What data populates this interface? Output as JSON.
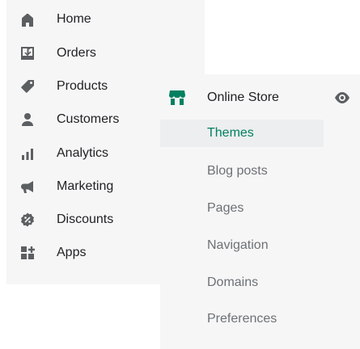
{
  "main_nav": {
    "items": [
      {
        "label": "Home",
        "icon": "home-icon"
      },
      {
        "label": "Orders",
        "icon": "orders-icon"
      },
      {
        "label": "Products",
        "icon": "tag-icon"
      },
      {
        "label": "Customers",
        "icon": "person-icon"
      },
      {
        "label": "Analytics",
        "icon": "bar-chart-icon"
      },
      {
        "label": "Marketing",
        "icon": "megaphone-icon"
      },
      {
        "label": "Discounts",
        "icon": "discount-icon"
      },
      {
        "label": "Apps",
        "icon": "apps-icon"
      }
    ]
  },
  "online_store": {
    "label": "Online Store",
    "icon": "store-icon",
    "view_icon": "eye-icon",
    "items": [
      {
        "label": "Themes",
        "active": true
      },
      {
        "label": "Blog posts",
        "active": false
      },
      {
        "label": "Pages",
        "active": false
      },
      {
        "label": "Navigation",
        "active": false
      },
      {
        "label": "Domains",
        "active": false
      },
      {
        "label": "Preferences",
        "active": false
      }
    ]
  },
  "colors": {
    "panel_bg": "#f6f6f7",
    "icon": "#5c5f62",
    "text": "#202223",
    "subdued_text": "#6d7175",
    "accent_green": "#008060",
    "active_bg": "#eceeef"
  }
}
